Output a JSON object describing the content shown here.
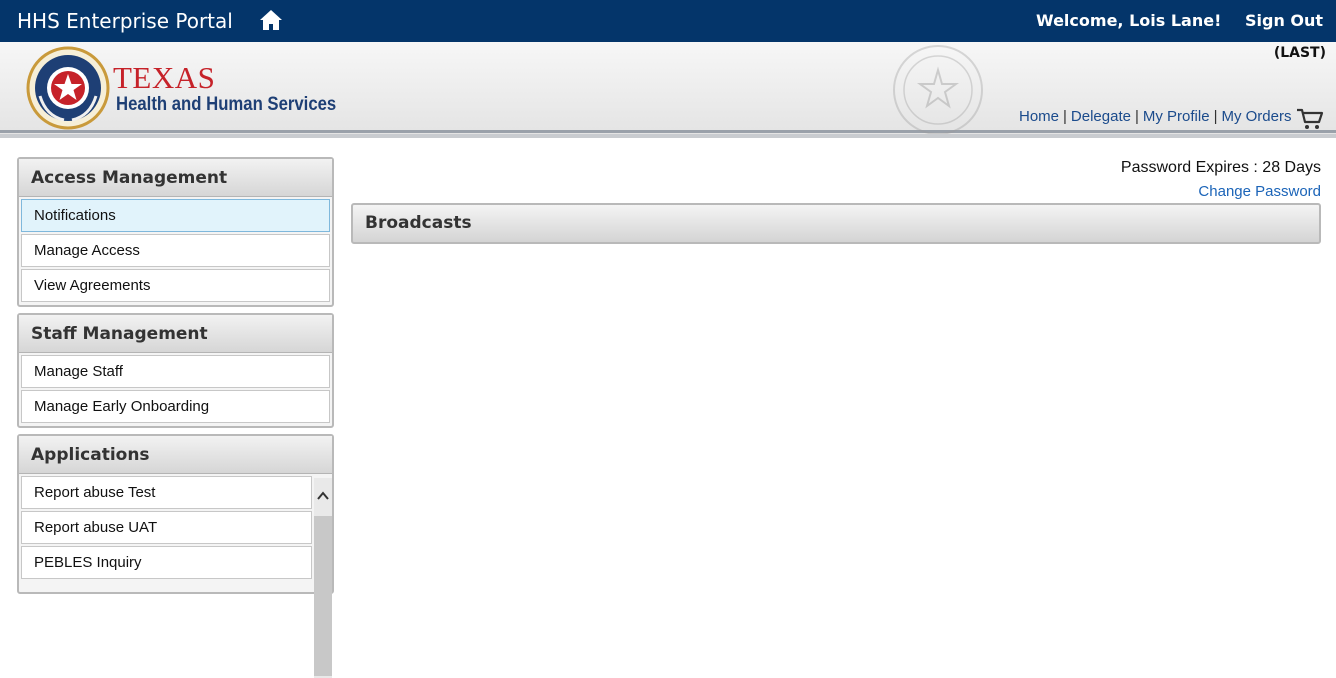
{
  "topbar": {
    "title": "HHS Enterprise Portal",
    "home_icon": "home-icon",
    "welcome": "Welcome, Lois Lane!",
    "signout": "Sign Out",
    "bg_color": "#04356a"
  },
  "header": {
    "logo_line1": "TEXAS",
    "logo_line2": "Health and Human Services",
    "role_tag": "(LAST)",
    "nav": [
      "Home",
      "Delegate",
      "My Profile",
      "My Orders"
    ],
    "cart_icon": "cart-icon"
  },
  "sidebar": {
    "sections": [
      {
        "title": "Access Management",
        "items": [
          "Notifications",
          "Manage Access",
          "View Agreements"
        ],
        "active_index": 0
      },
      {
        "title": "Staff Management",
        "items": [
          "Manage Staff",
          "Manage Early Onboarding"
        ]
      },
      {
        "title": "Applications",
        "items": [
          "Report abuse Test",
          "Report abuse UAT",
          "PEBLES Inquiry"
        ]
      }
    ]
  },
  "main": {
    "password_expires": "Password Expires : 28 Days",
    "change_password": "Change Password",
    "broadcasts_title": "Broadcasts"
  },
  "colors": {
    "brand_navy": "#04356a",
    "brand_red": "#c62229",
    "link_blue": "#1b64b8",
    "active_item": "#e1f3fb"
  }
}
